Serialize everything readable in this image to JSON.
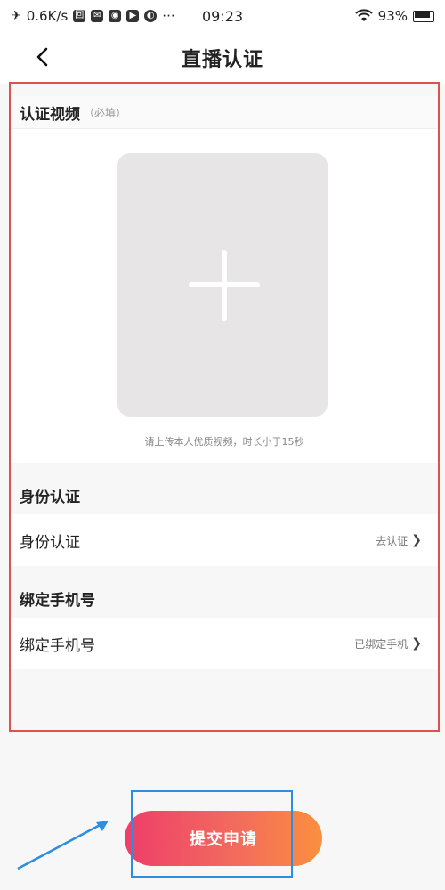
{
  "status_bar": {
    "speed": "0.6K/s",
    "time": "09:23",
    "battery": "93%",
    "dots": "···",
    "icons": [
      "airplane-icon",
      "app-icon-1",
      "mail-icon",
      "wechat-icon",
      "video-icon",
      "browser-icon",
      "wifi-icon",
      "battery-icon"
    ]
  },
  "header": {
    "title": "直播认证",
    "back_icon": "chevron-left-icon"
  },
  "video_section": {
    "title": "认证视频",
    "required": "（必填）",
    "hint": "请上传本人优质视频，时长小于15秒",
    "upload_icon": "plus-icon"
  },
  "id_section": {
    "title": "身份认证",
    "row_label": "身份认证",
    "row_status": "去认证"
  },
  "phone_section": {
    "title": "绑定手机号",
    "row_label": "绑定手机号",
    "row_status": "已绑定手机"
  },
  "submit": {
    "label": "提交申请"
  },
  "colors": {
    "outline_red": "#d9534f",
    "outline_blue": "#2d8de0",
    "gradient_start": "#ee3e6a",
    "gradient_end": "#fb8f3e",
    "upload_bg": "#e7e5e6"
  }
}
